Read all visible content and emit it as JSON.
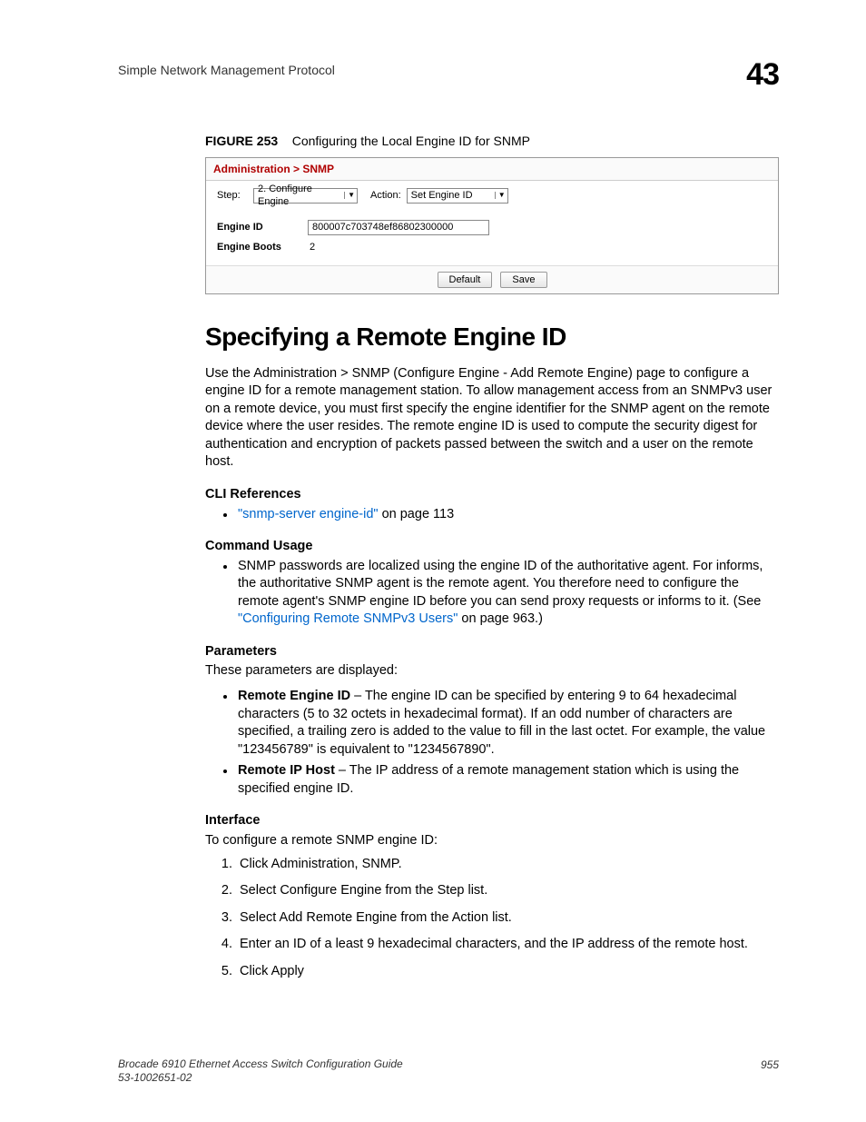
{
  "header": {
    "left": "Simple Network Management Protocol",
    "right": "43"
  },
  "figure": {
    "label": "FIGURE 253",
    "caption": "Configuring the Local Engine ID for SNMP"
  },
  "screenshot": {
    "breadcrumb": "Administration > SNMP",
    "step_label": "Step:",
    "step_value": "2. Configure Engine",
    "action_label": "Action:",
    "action_value": "Set Engine ID",
    "engine_id_label": "Engine ID",
    "engine_id_value": "800007c703748ef86802300000",
    "engine_boots_label": "Engine Boots",
    "engine_boots_value": "2",
    "btn_default": "Default",
    "btn_save": "Save"
  },
  "section_title": "Specifying a Remote Engine ID",
  "intro": "Use the Administration > SNMP (Configure Engine - Add Remote Engine) page to configure a engine ID for a remote management station. To allow management access from an SNMPv3 user on a remote device, you must first specify the engine identifier for the SNMP agent on the remote device where the user resides. The remote engine ID is used to compute the security digest for authentication and encryption of packets passed between the switch and a user on the remote host.",
  "cli_ref_head": "CLI References",
  "cli_ref_link": "\"snmp-server engine-id\"",
  "cli_ref_suffix": " on page 113",
  "cmd_usage_head": "Command Usage",
  "cmd_usage_text_a": "SNMP passwords are localized using the engine ID of the authoritative agent. For informs, the authoritative SNMP agent is the remote agent. You therefore need to configure the remote agent's SNMP engine ID before you can send proxy requests or informs to it. (See ",
  "cmd_usage_link": "\"Configuring Remote SNMPv3 Users\"",
  "cmd_usage_text_b": " on page 963.)",
  "params_head": "Parameters",
  "params_intro": "These parameters are displayed:",
  "param1_name": "Remote Engine ID",
  "param1_desc": " – The engine ID can be specified by entering 9 to 64 hexadecimal characters (5 to 32 octets in hexadecimal format). If an odd number of characters are specified, a trailing zero is added to the value to fill in the last octet. For example, the value \"123456789\" is equivalent to \"1234567890\".",
  "param2_name": "Remote IP Host",
  "param2_desc": " – The IP address of a remote management station which is using the specified engine ID.",
  "iface_head": "Interface",
  "iface_intro": "To configure a remote SNMP engine ID:",
  "steps": {
    "s1": "Click Administration, SNMP.",
    "s2": "Select Configure Engine from the Step list.",
    "s3": "Select Add Remote Engine from the Action list.",
    "s4": "Enter an ID of a least 9 hexadecimal characters, and the IP address of the remote host.",
    "s5": "Click Apply"
  },
  "footer": {
    "title": "Brocade 6910 Ethernet Access Switch Configuration Guide",
    "docnum": "53-1002651-02",
    "page": "955"
  }
}
